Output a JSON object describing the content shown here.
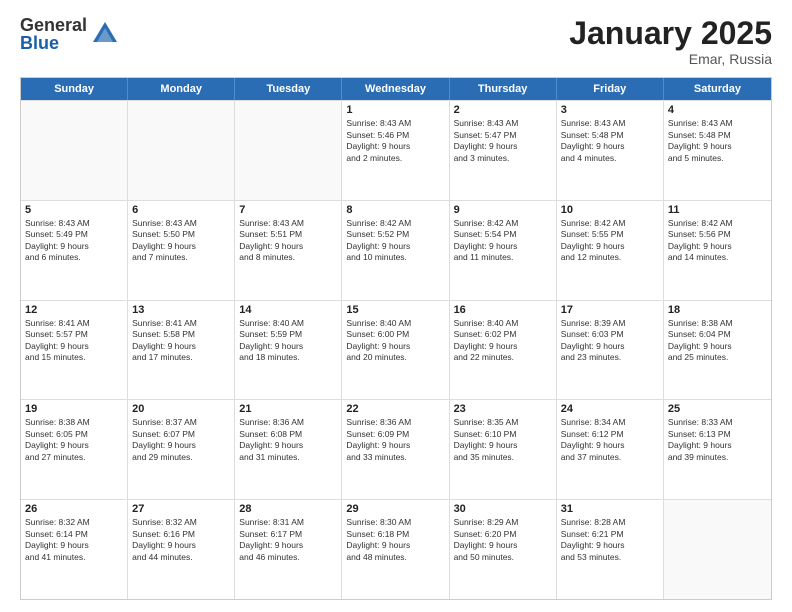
{
  "logo": {
    "general": "General",
    "blue": "Blue"
  },
  "title": "January 2025",
  "location": "Emar, Russia",
  "header_days": [
    "Sunday",
    "Monday",
    "Tuesday",
    "Wednesday",
    "Thursday",
    "Friday",
    "Saturday"
  ],
  "weeks": [
    [
      {
        "day": "",
        "info": ""
      },
      {
        "day": "",
        "info": ""
      },
      {
        "day": "",
        "info": ""
      },
      {
        "day": "1",
        "info": "Sunrise: 8:43 AM\nSunset: 5:46 PM\nDaylight: 9 hours\nand 2 minutes."
      },
      {
        "day": "2",
        "info": "Sunrise: 8:43 AM\nSunset: 5:47 PM\nDaylight: 9 hours\nand 3 minutes."
      },
      {
        "day": "3",
        "info": "Sunrise: 8:43 AM\nSunset: 5:48 PM\nDaylight: 9 hours\nand 4 minutes."
      },
      {
        "day": "4",
        "info": "Sunrise: 8:43 AM\nSunset: 5:48 PM\nDaylight: 9 hours\nand 5 minutes."
      }
    ],
    [
      {
        "day": "5",
        "info": "Sunrise: 8:43 AM\nSunset: 5:49 PM\nDaylight: 9 hours\nand 6 minutes."
      },
      {
        "day": "6",
        "info": "Sunrise: 8:43 AM\nSunset: 5:50 PM\nDaylight: 9 hours\nand 7 minutes."
      },
      {
        "day": "7",
        "info": "Sunrise: 8:43 AM\nSunset: 5:51 PM\nDaylight: 9 hours\nand 8 minutes."
      },
      {
        "day": "8",
        "info": "Sunrise: 8:42 AM\nSunset: 5:52 PM\nDaylight: 9 hours\nand 10 minutes."
      },
      {
        "day": "9",
        "info": "Sunrise: 8:42 AM\nSunset: 5:54 PM\nDaylight: 9 hours\nand 11 minutes."
      },
      {
        "day": "10",
        "info": "Sunrise: 8:42 AM\nSunset: 5:55 PM\nDaylight: 9 hours\nand 12 minutes."
      },
      {
        "day": "11",
        "info": "Sunrise: 8:42 AM\nSunset: 5:56 PM\nDaylight: 9 hours\nand 14 minutes."
      }
    ],
    [
      {
        "day": "12",
        "info": "Sunrise: 8:41 AM\nSunset: 5:57 PM\nDaylight: 9 hours\nand 15 minutes."
      },
      {
        "day": "13",
        "info": "Sunrise: 8:41 AM\nSunset: 5:58 PM\nDaylight: 9 hours\nand 17 minutes."
      },
      {
        "day": "14",
        "info": "Sunrise: 8:40 AM\nSunset: 5:59 PM\nDaylight: 9 hours\nand 18 minutes."
      },
      {
        "day": "15",
        "info": "Sunrise: 8:40 AM\nSunset: 6:00 PM\nDaylight: 9 hours\nand 20 minutes."
      },
      {
        "day": "16",
        "info": "Sunrise: 8:40 AM\nSunset: 6:02 PM\nDaylight: 9 hours\nand 22 minutes."
      },
      {
        "day": "17",
        "info": "Sunrise: 8:39 AM\nSunset: 6:03 PM\nDaylight: 9 hours\nand 23 minutes."
      },
      {
        "day": "18",
        "info": "Sunrise: 8:38 AM\nSunset: 6:04 PM\nDaylight: 9 hours\nand 25 minutes."
      }
    ],
    [
      {
        "day": "19",
        "info": "Sunrise: 8:38 AM\nSunset: 6:05 PM\nDaylight: 9 hours\nand 27 minutes."
      },
      {
        "day": "20",
        "info": "Sunrise: 8:37 AM\nSunset: 6:07 PM\nDaylight: 9 hours\nand 29 minutes."
      },
      {
        "day": "21",
        "info": "Sunrise: 8:36 AM\nSunset: 6:08 PM\nDaylight: 9 hours\nand 31 minutes."
      },
      {
        "day": "22",
        "info": "Sunrise: 8:36 AM\nSunset: 6:09 PM\nDaylight: 9 hours\nand 33 minutes."
      },
      {
        "day": "23",
        "info": "Sunrise: 8:35 AM\nSunset: 6:10 PM\nDaylight: 9 hours\nand 35 minutes."
      },
      {
        "day": "24",
        "info": "Sunrise: 8:34 AM\nSunset: 6:12 PM\nDaylight: 9 hours\nand 37 minutes."
      },
      {
        "day": "25",
        "info": "Sunrise: 8:33 AM\nSunset: 6:13 PM\nDaylight: 9 hours\nand 39 minutes."
      }
    ],
    [
      {
        "day": "26",
        "info": "Sunrise: 8:32 AM\nSunset: 6:14 PM\nDaylight: 9 hours\nand 41 minutes."
      },
      {
        "day": "27",
        "info": "Sunrise: 8:32 AM\nSunset: 6:16 PM\nDaylight: 9 hours\nand 44 minutes."
      },
      {
        "day": "28",
        "info": "Sunrise: 8:31 AM\nSunset: 6:17 PM\nDaylight: 9 hours\nand 46 minutes."
      },
      {
        "day": "29",
        "info": "Sunrise: 8:30 AM\nSunset: 6:18 PM\nDaylight: 9 hours\nand 48 minutes."
      },
      {
        "day": "30",
        "info": "Sunrise: 8:29 AM\nSunset: 6:20 PM\nDaylight: 9 hours\nand 50 minutes."
      },
      {
        "day": "31",
        "info": "Sunrise: 8:28 AM\nSunset: 6:21 PM\nDaylight: 9 hours\nand 53 minutes."
      },
      {
        "day": "",
        "info": ""
      }
    ]
  ]
}
